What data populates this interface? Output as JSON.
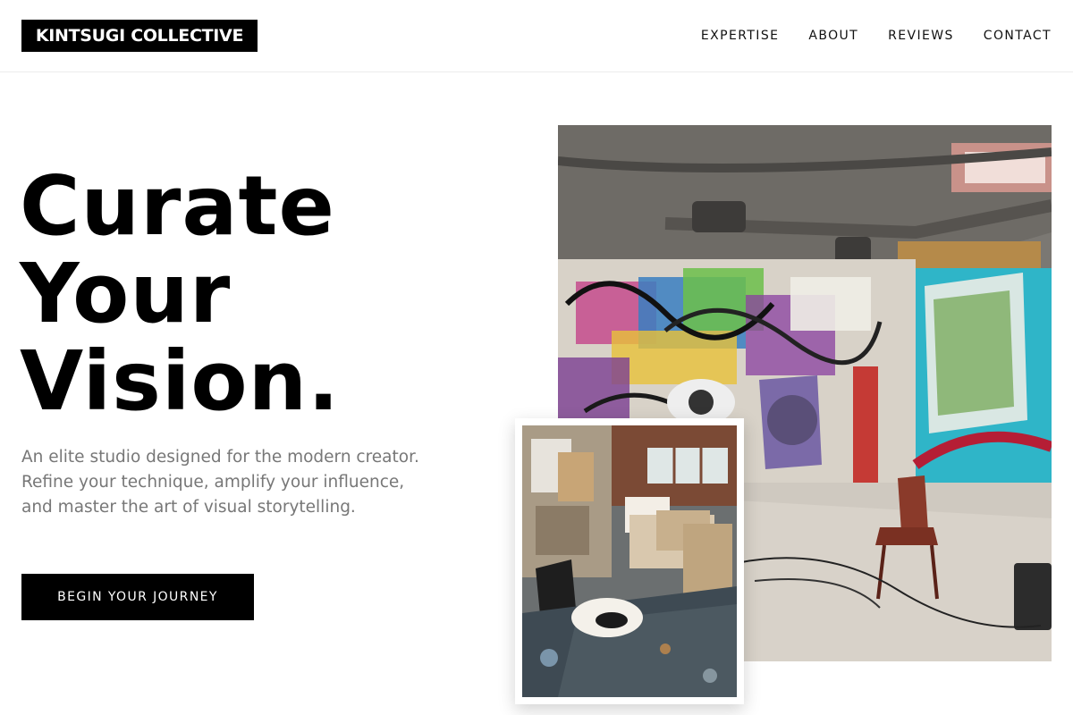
{
  "header": {
    "logo": "KINTSUGI COLLECTIVE",
    "nav": [
      "EXPERTISE",
      "ABOUT",
      "REVIEWS",
      "CONTACT"
    ]
  },
  "hero": {
    "headline": [
      "Curate",
      "Your",
      "Vision."
    ],
    "description": "An elite studio designed for the modern creator. Refine your technique, amplify your influence, and master the art of visual storytelling.",
    "cta": "BEGIN YOUR JOURNEY"
  },
  "images": {
    "large_alt": "Graffiti-covered art studio",
    "small_alt": "Artist studio with canvases"
  },
  "colors": {
    "text": "#000000",
    "muted": "#777777",
    "button_bg": "#000000",
    "button_text": "#ffffff"
  }
}
